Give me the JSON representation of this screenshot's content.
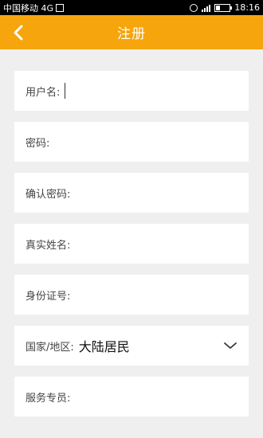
{
  "status_bar": {
    "carrier": "中国移动 4G",
    "time": "18:16"
  },
  "header": {
    "title": "注册"
  },
  "form": {
    "fields": [
      {
        "label": "用户名:",
        "value": ""
      },
      {
        "label": "密码:",
        "value": ""
      },
      {
        "label": "确认密码:",
        "value": ""
      },
      {
        "label": "真实姓名:",
        "value": ""
      },
      {
        "label": "身份证号:",
        "value": ""
      },
      {
        "label": "国家/地区:",
        "value": "大陆居民"
      },
      {
        "label": "服务专员:",
        "value": ""
      }
    ]
  },
  "colors": {
    "header_bg": "#f6a50c",
    "page_bg": "#efefef"
  }
}
